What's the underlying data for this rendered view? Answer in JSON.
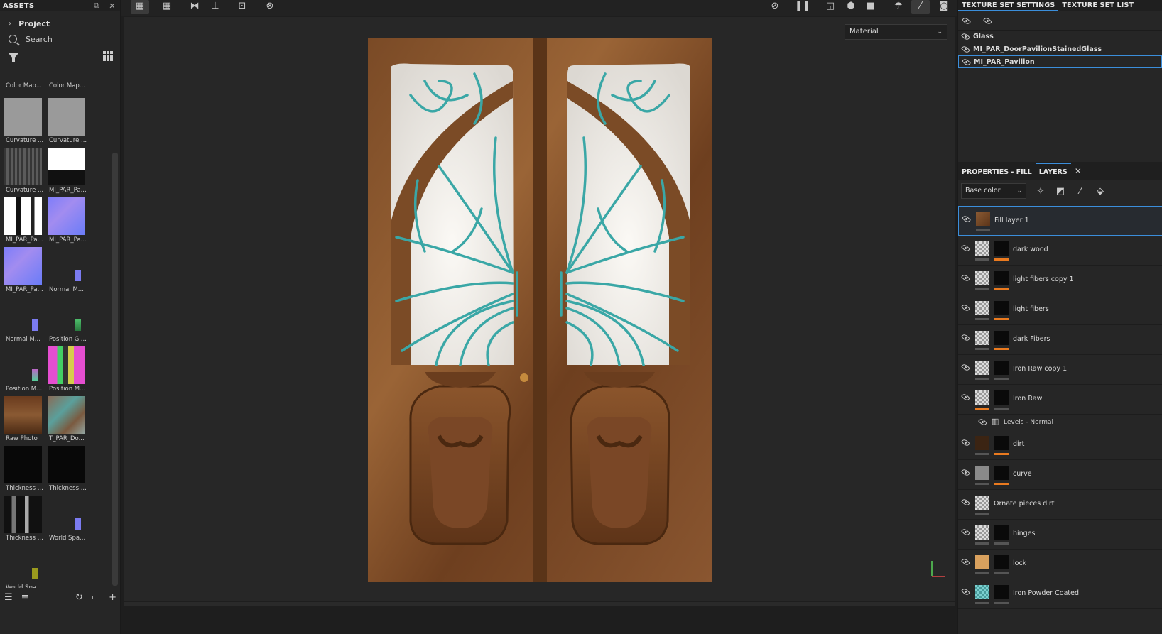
{
  "assets": {
    "title": "ASSETS",
    "project_label": "Project",
    "search_label": "Search",
    "thumbnails": [
      {
        "label": "Color Map...",
        "kind": "none"
      },
      {
        "label": "Color Map...",
        "kind": "none"
      },
      {
        "label": "Curvature ...",
        "kind": "gray"
      },
      {
        "label": "Curvature ...",
        "kind": "gray"
      },
      {
        "label": "Curvature ...",
        "kind": "curv"
      },
      {
        "label": "MI_PAR_Pa...",
        "kind": "maskw"
      },
      {
        "label": "MI_PAR_Pa...",
        "kind": "mask"
      },
      {
        "label": "MI_PAR_Pa...",
        "kind": "norm"
      },
      {
        "label": "MI_PAR_Pa...",
        "kind": "norm"
      },
      {
        "label": "Normal M...",
        "kind": "tiny tinyb"
      },
      {
        "label": "Normal M...",
        "kind": "tiny tinyb"
      },
      {
        "label": "Position Gl...",
        "kind": "tiny tinyg"
      },
      {
        "label": "Position M...",
        "kind": "tiny tinyp"
      },
      {
        "label": "Position M...",
        "kind": "pos"
      },
      {
        "label": "Raw Photo",
        "kind": "photo"
      },
      {
        "label": "T_PAR_Do...",
        "kind": "tpar"
      },
      {
        "label": "Thickness ...",
        "kind": "thick"
      },
      {
        "label": "Thickness ...",
        "kind": "thick"
      },
      {
        "label": "Thickness ...",
        "kind": "thick2"
      },
      {
        "label": "World Spa...",
        "kind": "tiny tinyb"
      },
      {
        "label": "World Spa...",
        "kind": "tiny tinyy"
      }
    ]
  },
  "viewport": {
    "material_mode": "Material"
  },
  "texture_set": {
    "tab_settings": "TEXTURE SET SETTINGS",
    "tab_list": "TEXTURE SET LIST",
    "items": [
      {
        "name": "Glass",
        "selected": false
      },
      {
        "name": "MI_PAR_DoorPavilionStainedGlass",
        "selected": false
      },
      {
        "name": "MI_PAR_Pavilion",
        "selected": true
      }
    ]
  },
  "properties": {
    "tab_props": "PROPERTIES - FILL",
    "tab_layers": "LAYERS",
    "channel": "Base color"
  },
  "layers": [
    {
      "name": "Fill layer 1",
      "type": "fill",
      "thumb": "woodthumb",
      "mask": "",
      "orange": false,
      "selected": true
    },
    {
      "name": "dark wood",
      "type": "layer",
      "thumb": "checker",
      "mask": "mask2",
      "orange": true
    },
    {
      "name": "light fibers copy 1",
      "type": "layer",
      "thumb": "checker",
      "mask": "",
      "orange": true
    },
    {
      "name": "light fibers",
      "type": "layer",
      "thumb": "checker",
      "mask": "",
      "orange": true
    },
    {
      "name": "dark Fibers",
      "type": "layer",
      "thumb": "checker",
      "mask": "",
      "orange": true
    },
    {
      "name": "Iron Raw copy 1",
      "type": "layer",
      "thumb": "checker",
      "mask": "",
      "orange": false
    },
    {
      "name": "Iron Raw",
      "type": "layer",
      "thumb": "checker",
      "mask": "",
      "orange": false,
      "orange_left": true
    },
    {
      "name": "Levels - Normal",
      "type": "sub"
    },
    {
      "name": "dirt",
      "type": "layer",
      "thumb": "dirtthumb",
      "mask": "mask2",
      "orange": true
    },
    {
      "name": "curve",
      "type": "layer",
      "thumb": "greythumb",
      "mask": "mask2",
      "orange": true
    },
    {
      "name": "Ornate pieces dirt",
      "type": "fill",
      "thumb": "checker",
      "mask": "",
      "orange": false
    },
    {
      "name": "hinges",
      "type": "layer",
      "thumb": "checker",
      "mask": "",
      "orange": false
    },
    {
      "name": "lock",
      "type": "layer",
      "thumb": "tanthumb",
      "mask": "",
      "orange": false
    },
    {
      "name": "Iron Powder Coated",
      "type": "layer",
      "thumb": "tealthumb",
      "mask": "",
      "orange": false
    }
  ]
}
